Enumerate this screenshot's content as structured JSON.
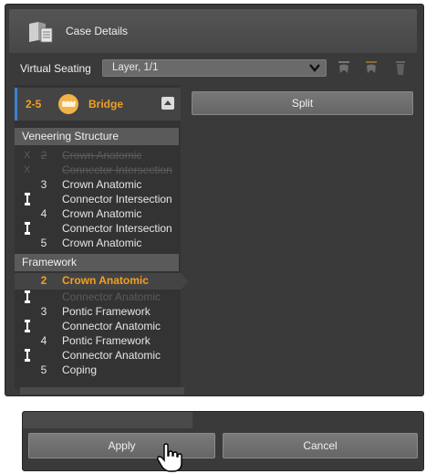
{
  "window": {
    "title": "Case Details"
  },
  "seating": {
    "label": "Virtual Seating",
    "selected": "Layer, 1/1",
    "tools": [
      "tooth-up-icon",
      "tooth-down-icon",
      "trash-icon"
    ]
  },
  "bridge": {
    "range": "2-5",
    "name": "Bridge",
    "split_label": "Split"
  },
  "veneering": {
    "header": "Veneering Structure",
    "rows": [
      {
        "num": "2",
        "label": "Crown Anatomic"
      },
      {
        "num": "",
        "label": "Connector Intersection"
      },
      {
        "num": "3",
        "label": "Crown Anatomic"
      },
      {
        "num": "",
        "label": "Connector Intersection"
      },
      {
        "num": "4",
        "label": "Crown Anatomic"
      },
      {
        "num": "",
        "label": "Connector Intersection"
      },
      {
        "num": "5",
        "label": "Crown Anatomic"
      }
    ]
  },
  "framework": {
    "header": "Framework",
    "rows": [
      {
        "num": "2",
        "label": "Crown Anatomic"
      },
      {
        "num": "",
        "label": "Connector Anatomic"
      },
      {
        "num": "3",
        "label": "Pontic Framework"
      },
      {
        "num": "",
        "label": "Connector Anatomic"
      },
      {
        "num": "4",
        "label": "Pontic Framework"
      },
      {
        "num": "",
        "label": "Connector Anatomic"
      },
      {
        "num": "5",
        "label": "Coping"
      }
    ]
  },
  "actions": {
    "apply": "Apply",
    "cancel": "Cancel"
  },
  "colors": {
    "accent": "#f2a01e",
    "selection_bar": "#3f7fd1",
    "panel": "#3a3a3a"
  }
}
